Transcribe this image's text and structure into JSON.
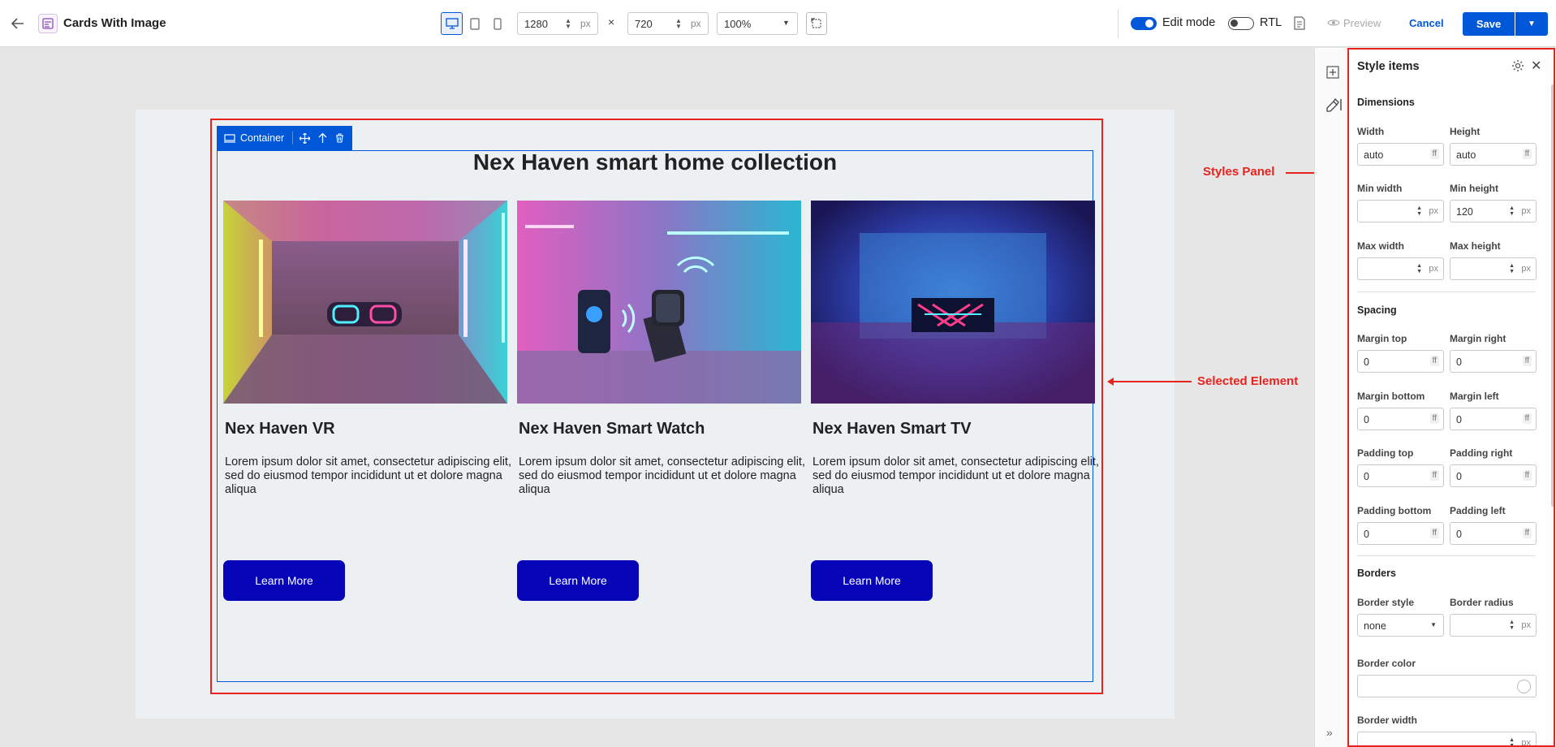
{
  "header": {
    "title": "Cards With Image",
    "width_value": "1280",
    "height_value": "720",
    "unit": "px",
    "times": "×",
    "zoom": "100%",
    "edit_mode_label": "Edit mode",
    "rtl_label": "RTL",
    "preview_label": "Preview",
    "cancel_label": "Cancel",
    "save_label": "Save"
  },
  "toolbar": {
    "container_label": "Container"
  },
  "page": {
    "heading": "Nex Haven smart home collection",
    "cards": [
      {
        "title": "Nex Haven VR",
        "text": "Lorem ipsum dolor sit amet, consectetur adipiscing elit, sed do eiusmod tempor incididunt ut et dolore magna aliqua",
        "button": "Learn More"
      },
      {
        "title": "Nex Haven Smart Watch",
        "text": "Lorem ipsum dolor sit amet, consectetur adipiscing elit, sed do eiusmod tempor incididunt ut et dolore magna aliqua",
        "button": "Learn More"
      },
      {
        "title": "Nex Haven Smart TV",
        "text": "Lorem ipsum dolor sit amet, consectetur adipiscing elit, sed do eiusmod tempor incididunt ut et dolore magna aliqua",
        "button": "Learn More"
      }
    ]
  },
  "annotations": {
    "styles_panel": "Styles Panel",
    "selected_element": "Selected Element"
  },
  "panel": {
    "title": "Style items",
    "dimensions": {
      "heading": "Dimensions",
      "width_label": "Width",
      "width_value": "auto",
      "height_label": "Height",
      "height_value": "auto",
      "min_width_label": "Min width",
      "min_width_value": "",
      "min_height_label": "Min height",
      "min_height_value": "120",
      "max_width_label": "Max width",
      "max_width_value": "",
      "max_height_label": "Max height",
      "max_height_value": ""
    },
    "spacing": {
      "heading": "Spacing",
      "margin_top_label": "Margin top",
      "margin_top_value": "0",
      "margin_right_label": "Margin right",
      "margin_right_value": "0",
      "margin_bottom_label": "Margin bottom",
      "margin_bottom_value": "0",
      "margin_left_label": "Margin left",
      "margin_left_value": "0",
      "padding_top_label": "Padding top",
      "padding_top_value": "0",
      "padding_right_label": "Padding right",
      "padding_right_value": "0",
      "padding_bottom_label": "Padding bottom",
      "padding_bottom_value": "0",
      "padding_left_label": "Padding left",
      "padding_left_value": "0"
    },
    "borders": {
      "heading": "Borders",
      "style_label": "Border style",
      "style_value": "none",
      "radius_label": "Border radius",
      "radius_value": "",
      "color_label": "Border color",
      "width_label": "Border width"
    },
    "unit_px": "px",
    "unit_ff": "ff"
  },
  "colors": {
    "accent": "#0057d8",
    "button_fill": "#0606b8",
    "annotation_red": "#e8231e"
  }
}
